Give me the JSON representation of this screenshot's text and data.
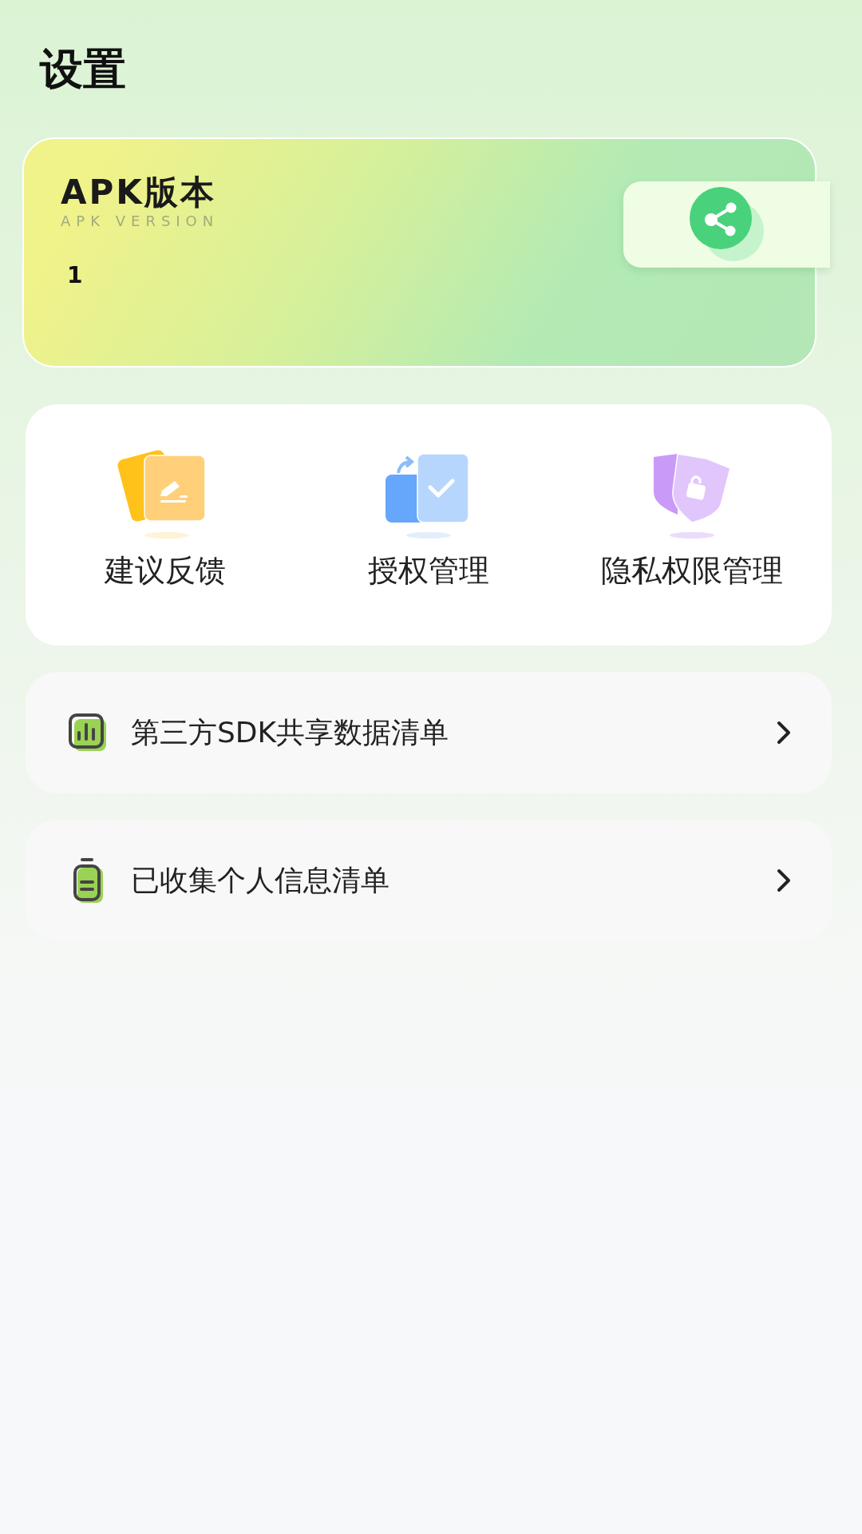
{
  "title": "设置",
  "version_card": {
    "title": "APK版本",
    "subtitle": "APK VERSION",
    "value": "1"
  },
  "shortcuts": [
    {
      "kind": "feedback",
      "label": "建议反馈"
    },
    {
      "kind": "authorization",
      "label": "授权管理"
    },
    {
      "kind": "privacy",
      "label": "隐私权限管理"
    }
  ],
  "list": [
    {
      "kind": "chart",
      "label": "第三方SDK共享数据清单"
    },
    {
      "kind": "document",
      "label": "已收集个人信息清单"
    }
  ]
}
